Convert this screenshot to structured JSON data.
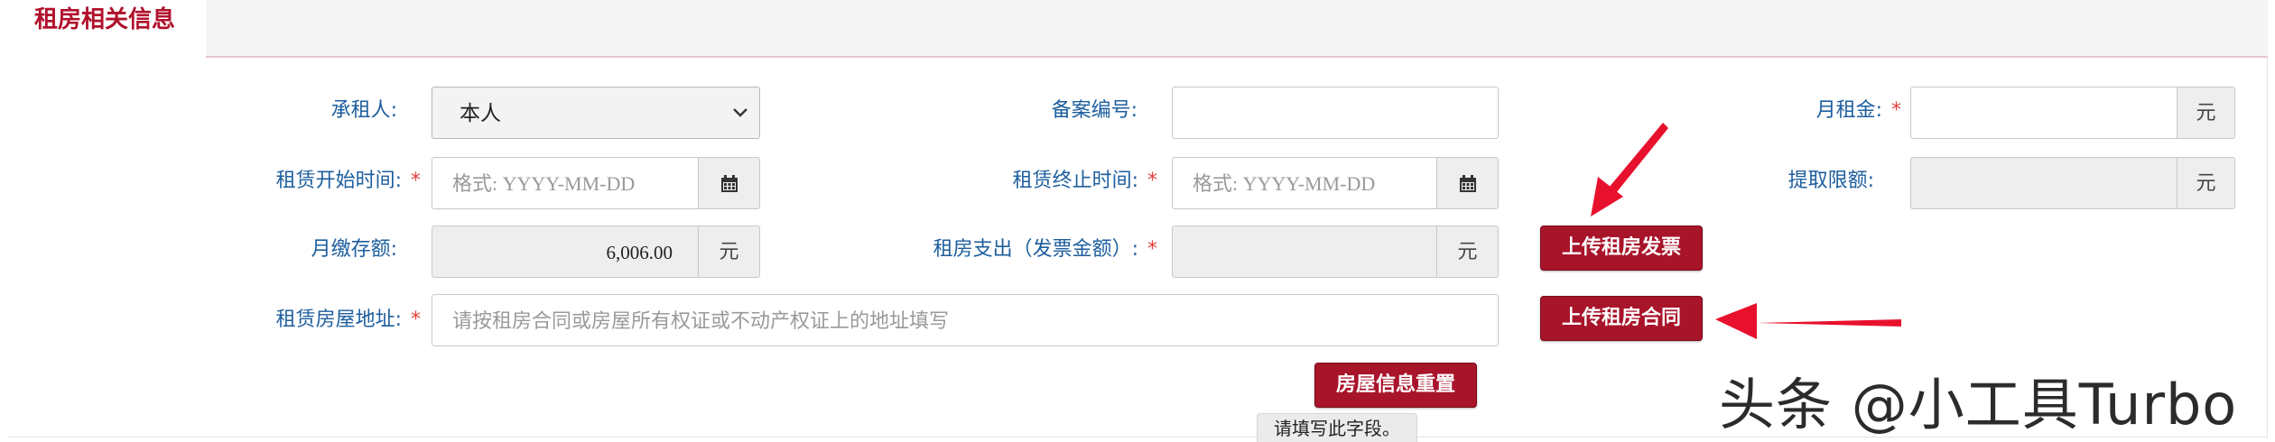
{
  "section": {
    "title": "租房相关信息"
  },
  "form": {
    "tenant": {
      "label": "承租人:",
      "value": "本人"
    },
    "record_no": {
      "label": "备案编号:",
      "value": ""
    },
    "monthly_rent": {
      "label": "月租金:",
      "required": "*",
      "value": "",
      "unit": "元"
    },
    "lease_start": {
      "label": "租赁开始时间:",
      "required": "*",
      "placeholder": "格式: YYYY-MM-DD"
    },
    "lease_end": {
      "label": "租赁终止时间:",
      "required": "*",
      "placeholder": "格式: YYYY-MM-DD"
    },
    "withdraw_limit": {
      "label": "提取限额:",
      "value": "",
      "unit": "元"
    },
    "monthly_deposit": {
      "label": "月缴存额:",
      "value": "6,006.00",
      "unit": "元"
    },
    "rent_expense": {
      "label": "租房支出（发票金额）:",
      "required": "*",
      "value": "",
      "unit": "元"
    },
    "address": {
      "label": "租赁房屋地址:",
      "required": "*",
      "placeholder": "请按租房合同或房屋所有权证或不动产权证上的地址填写"
    }
  },
  "buttons": {
    "upload_invoice": "上传租房发票",
    "upload_contract": "上传租房合同",
    "reset": "房屋信息重置"
  },
  "tooltip": "请填写此字段。",
  "watermark": "头条 @小工具Turbo",
  "icons": {
    "calendar": "calendar-icon",
    "dropdown": "chevron-down-icon"
  },
  "colors": {
    "accent": "#a8142a",
    "label": "#1d5e9e",
    "required": "#e0403a",
    "annotation_arrow": "#e8112d"
  }
}
